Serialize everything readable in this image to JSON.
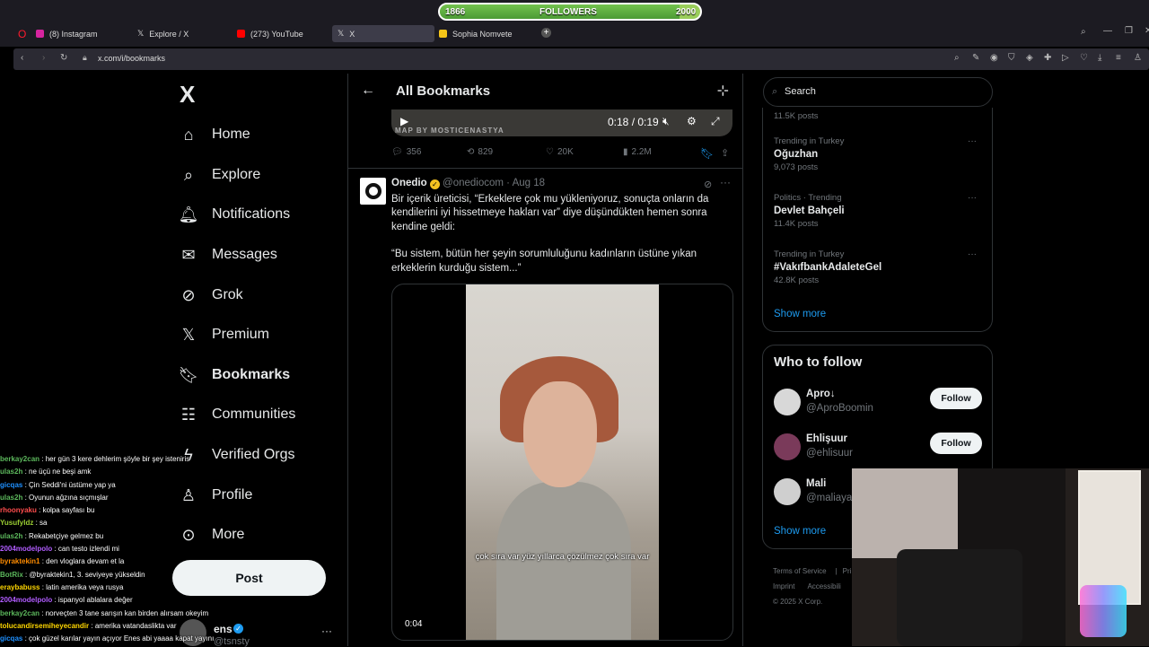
{
  "browser": {
    "tabs": [
      {
        "label": "(8) Instagram",
        "color": "#d6249f"
      },
      {
        "label": "Explore / X",
        "color": "#ffffff"
      },
      {
        "label": "(273) YouTube",
        "color": "#ff0000"
      },
      {
        "label": "X",
        "color": "#ffffff"
      },
      {
        "label": "Sophia Nomvete",
        "color": "#f5c518"
      }
    ],
    "url": "x.com/i/bookmarks"
  },
  "followers_bar": {
    "start": "1866",
    "label": "FOLLOWERS",
    "goal": "2000",
    "progress": 0.92
  },
  "nav": {
    "logo": "X",
    "items": [
      {
        "label": "Home",
        "icon": "home-icon"
      },
      {
        "label": "Explore",
        "icon": "search-icon"
      },
      {
        "label": "Notifications",
        "icon": "bell-icon"
      },
      {
        "label": "Messages",
        "icon": "envelope-icon"
      },
      {
        "label": "Grok",
        "icon": "grok-icon"
      },
      {
        "label": "Premium",
        "icon": "x-icon"
      },
      {
        "label": "Bookmarks",
        "icon": "bookmark-icon"
      },
      {
        "label": "Communities",
        "icon": "people-icon"
      },
      {
        "label": "Verified Orgs",
        "icon": "lightning-icon"
      },
      {
        "label": "Profile",
        "icon": "person-icon"
      },
      {
        "label": "More",
        "icon": "more-circle-icon"
      }
    ],
    "post_button": "Post",
    "account_name": "ens",
    "account_handle": "@tsnsty"
  },
  "chat": [
    {
      "user": "berkay2can",
      "color": "#5cb85c",
      "msg": "her gün 3 kere dehlerim şöyle bir şey isteniris"
    },
    {
      "user": "ulas2h",
      "color": "#5cb85c",
      "msg": "ne üçü ne beşi amk"
    },
    {
      "user": "gicqas",
      "color": "#1e90ff",
      "msg": "Çin Seddi'ni üstüme yap ya"
    },
    {
      "user": "ulas2h",
      "color": "#5cb85c",
      "msg": "Oyunun ağzına sıçmışlar"
    },
    {
      "user": "rhoonyaku",
      "color": "#ff4d4d",
      "msg": "kolpa sayfası bu"
    },
    {
      "user": "Yusufyldz",
      "color": "#9acd32",
      "msg": "sa"
    },
    {
      "user": "ulas2h",
      "color": "#5cb85c",
      "msg": "Rekabetçiye gelmez bu"
    },
    {
      "user": "2004modelpolo",
      "color": "#b15cff",
      "msg": "can testo izlendi mi"
    },
    {
      "user": "byraktekin1",
      "color": "#ff8c00",
      "msg": "den vloglara devam et la"
    },
    {
      "user": "BotRix",
      "color": "#5cb85c",
      "msg": "@byraktekin1, 3. seviyeye yükseldin"
    },
    {
      "user": "eraybabuss",
      "color": "#ffd700",
      "msg": "latin amerika veya rusya"
    },
    {
      "user": "2004modelpolo",
      "color": "#b15cff",
      "msg": "ispanyol ablalara değer"
    },
    {
      "user": "berkay2can",
      "color": "#5cb85c",
      "msg": "norveçten 3 tane sarışın kan birden alırsam okeyim"
    },
    {
      "user": "tolucandirsemiheyecandir",
      "color": "#ffd700",
      "msg": "amerika vatandaslikta var"
    },
    {
      "user": "gicqas",
      "color": "#1e90ff",
      "msg": "çok güzel karılar yayın açıyor Enes abi yaaaa kapat yayını"
    }
  ],
  "main": {
    "title": "All Bookmarks",
    "tweet1": {
      "video_time": "0:18 / 0:19",
      "credit": "MAP BY MOSTICENASTYA",
      "replies": "356",
      "retweets": "829",
      "likes": "20K",
      "views": "2.2M"
    },
    "tweet2": {
      "name": "Onedio",
      "handle": "@onediocom",
      "date": "Aug 18",
      "text1": "Bir içerik üreticisi, “Erkeklere çok mu yükleniyoruz, sonuçta onların da kendilerini iyi hissetmeye hakları var” diye düşündükten hemen sonra kendine geldi:",
      "text2": "“Bu sistem, bütün her şeyin sorumluluğunu kadınların üstüne yıkan erkeklerin kurduğu sistem...”",
      "caption": "çok sıra var yüz yıllarca çözülmez çok sıra var",
      "video_time": "0:04"
    }
  },
  "right": {
    "search_placeholder": "Search",
    "top_count": "11.5K posts",
    "trends": [
      {
        "context": "Trending in Turkey",
        "name": "Oğuzhan",
        "count": "9,073 posts"
      },
      {
        "context": "Politics · Trending",
        "name": "Devlet Bahçeli",
        "count": "11.4K posts"
      },
      {
        "context": "Trending in Turkey",
        "name": "#VakıfbankAdaleteGel",
        "count": "42.8K posts"
      }
    ],
    "show_more": "Show more",
    "who_to_follow": "Who to follow",
    "suggestions": [
      {
        "name": "Apro↓",
        "handle": "@AproBoomin",
        "button": "Follow"
      },
      {
        "name": "Ehlişuur",
        "handle": "@ehlisuur",
        "button": "Follow"
      },
      {
        "name": "Mali",
        "handle": "@maliayar",
        "button": "Follow"
      }
    ],
    "show_more2": "Show more",
    "footer": [
      "Terms of Service",
      "Imprint",
      "© 2025 X Corp."
    ],
    "footer_partial": [
      "Pri",
      "Accessibili"
    ]
  }
}
